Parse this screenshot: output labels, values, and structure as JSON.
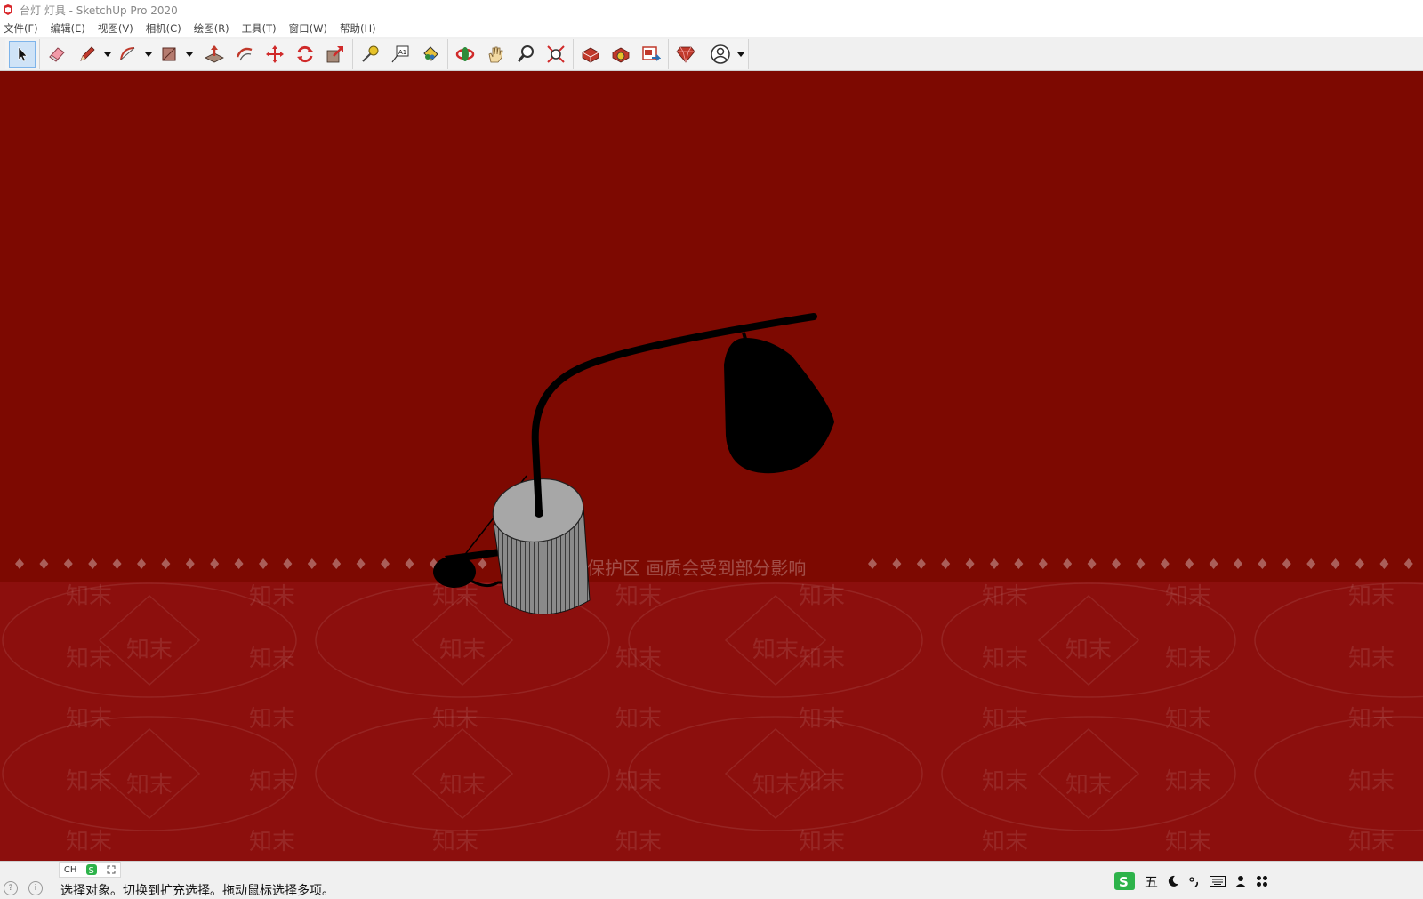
{
  "window": {
    "title": "台灯 灯具 - SketchUp Pro 2020"
  },
  "menu": [
    {
      "label": "文件(F)"
    },
    {
      "label": "编辑(E)"
    },
    {
      "label": "视图(V)"
    },
    {
      "label": "相机(C)"
    },
    {
      "label": "绘图(R)"
    },
    {
      "label": "工具(T)"
    },
    {
      "label": "窗口(W)"
    },
    {
      "label": "帮助(H)"
    }
  ],
  "toolbar": {
    "groups": [
      [
        "select-icon"
      ],
      [
        "eraser-icon",
        "pencil-icon",
        "arc-icon",
        "rectangle-icon"
      ],
      [
        "push-pull-icon",
        "offset-icon",
        "move-icon",
        "rotate-icon",
        "scale-icon"
      ],
      [
        "tape-measure-icon",
        "text-icon",
        "paint-bucket-icon"
      ],
      [
        "orbit-icon",
        "pan-icon",
        "zoom-icon",
        "zoom-extents-icon"
      ],
      [
        "3d-warehouse-icon",
        "extension-warehouse-icon",
        "layout-icon"
      ],
      [
        "ruby-icon"
      ],
      [
        "account-icon"
      ]
    ],
    "active": "select-icon"
  },
  "viewport": {
    "background_color": "#7d0901",
    "watermark": {
      "banner": "水印保护区  画质会受到部分影响",
      "repeat_text": "知末"
    }
  },
  "statusbar": {
    "message": "选择对象。切换到扩充选择。拖动鼠标选择多项。",
    "ime_mini_label": "CH",
    "ime_tray": {
      "mode_label": "五"
    }
  }
}
